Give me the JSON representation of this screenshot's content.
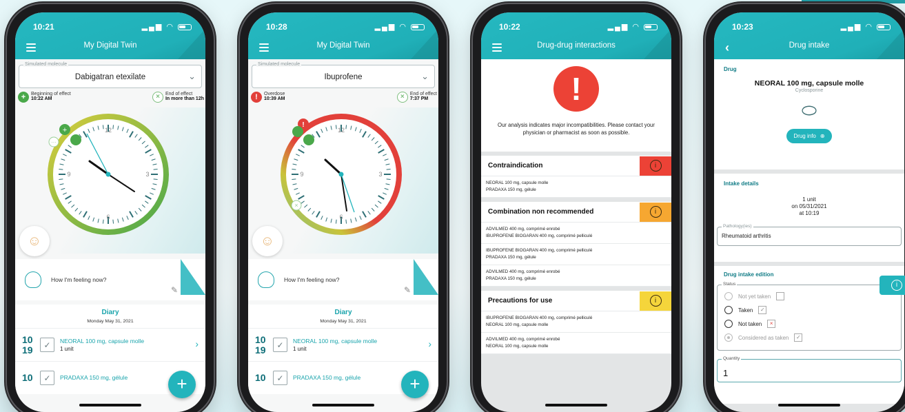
{
  "colors": {
    "teal": "#23b4bc",
    "red": "#ec4236",
    "orange": "#f6a731",
    "yellow": "#f5d53b",
    "green": "#4aa84a"
  },
  "phone1": {
    "time": "10:21",
    "title": "My Digital Twin",
    "molecule_legend": "Simulated molecule",
    "molecule": "Dabigatran etexilate",
    "left_label": "Beginning of effect",
    "left_value": "10:22 AM",
    "right_label": "End of effect",
    "right_value": "In more than 12h",
    "feeling": "How I'm feeling now?",
    "diary_title": "Diary",
    "diary_date": "Monday May 31, 2021",
    "entries": [
      {
        "h": "10",
        "m": "19",
        "name": "NEORAL 100 mg, capsule molle",
        "qty": "1 unit"
      },
      {
        "h": "10",
        "m": "",
        "name": "PRADAXA 150 mg, gélule",
        "qty": ""
      }
    ]
  },
  "phone2": {
    "time": "10:28",
    "title": "My Digital Twin",
    "molecule_legend": "Simulated molecule",
    "molecule": "Ibuprofene",
    "left_label": "Overdose",
    "left_value": "10:39 AM",
    "right_label": "End of effect",
    "right_value": "7:37 PM",
    "feeling": "How I'm feeling now?",
    "diary_title": "Diary",
    "diary_date": "Monday May 31, 2021",
    "entries": [
      {
        "h": "10",
        "m": "19",
        "name": "NEORAL 100 mg, capsule molle",
        "qty": "1 unit"
      },
      {
        "h": "10",
        "m": "",
        "name": "PRADAXA 150 mg, gélule",
        "qty": ""
      }
    ]
  },
  "clock_labels": {
    "twelve": "12",
    "three": "3",
    "six": "6",
    "nine": "9"
  },
  "phone3": {
    "time": "10:22",
    "title": "Drug-drug interactions",
    "alert_text": "Our analysis indicates major incompatibilities. Please contact your physician or pharmacist as soon as possible.",
    "sections": [
      {
        "title": "Contraindication",
        "level": "red",
        "pairs": [
          [
            "NEORAL 100 mg, capsule molle",
            "PRADAXA 150 mg, gélule"
          ]
        ]
      },
      {
        "title": "Combination non recommended",
        "level": "orange",
        "pairs": [
          [
            "ADVILMED 400 mg, comprimé enrobé",
            "IBUPROFENE BIOGARAN 400 mg, comprimé pelliculé"
          ],
          [
            "IBUPROFENE BIOGARAN 400 mg, comprimé pelliculé",
            "PRADAXA 150 mg, gélule"
          ],
          [
            "ADVILMED 400 mg, comprimé enrobé",
            "PRADAXA 150 mg, gélule"
          ]
        ]
      },
      {
        "title": "Precautions for use",
        "level": "yellow",
        "pairs": [
          [
            "IBUPROFENE BIOGARAN 400 mg, comprimé pelliculé",
            "NEORAL 100 mg, capsule molle"
          ],
          [
            "ADVILMED 400 mg, comprimé enrobé",
            "NEORAL 100 mg, capsule molle"
          ]
        ]
      }
    ],
    "badge_glyph": "i"
  },
  "phone4": {
    "time": "10:23",
    "title": "Drug intake",
    "drug_label": "Drug",
    "drug_name": "NEORAL 100 mg, capsule molle",
    "drug_molecule": "Cyclosporine",
    "drug_info": "Drug info",
    "intake_label": "Intake details",
    "intake_qty": "1 unit",
    "intake_date": "on 05/31/2021",
    "intake_time": "at 10:19",
    "pathology_legend": "Pathology(ies)",
    "pathology": "Rheumatoid arthritis",
    "edition_label": "Drug intake edition",
    "status_legend": "Status",
    "status_options": [
      "Not yet taken",
      "Taken",
      "Not taken",
      "Considered as taken"
    ],
    "quantity_legend": "Quantity",
    "quantity": "1"
  }
}
